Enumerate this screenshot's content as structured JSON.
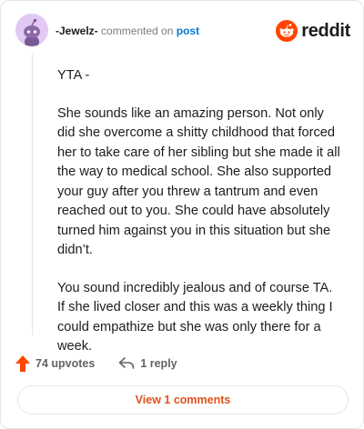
{
  "header": {
    "author": "-Jewelz-",
    "action_text": "commented on",
    "post_link": "post",
    "brand": "reddit"
  },
  "comment": {
    "paragraphs": [
      "YTA -",
      "She sounds like an amazing person. Not only did she overcome a shitty childhood that forced her to take care of her sibling but she made it all the way to medical school. She also supported your guy after you threw a tantrum and even reached out to you. She could have absolutely turned him against you in this situation but she didn’t.",
      "You sound incredibly jealous and of course TA. If she lived closer and this was a weekly thing I could empathize but she was only there for a week."
    ]
  },
  "actions": {
    "upvotes": "74 upvotes",
    "replies": "1 reply"
  },
  "view_comments_label": "View 1 comments",
  "colors": {
    "brand_orange": "#ff4500",
    "link_blue": "#0079d3",
    "upvote_orange": "#ff4500",
    "view_comments": "#e0531e"
  },
  "icons": {
    "avatar": "snoo-avatar",
    "brand": "reddit-logo-icon",
    "upvote": "upvote-arrow-icon",
    "reply": "reply-arrow-icon"
  }
}
